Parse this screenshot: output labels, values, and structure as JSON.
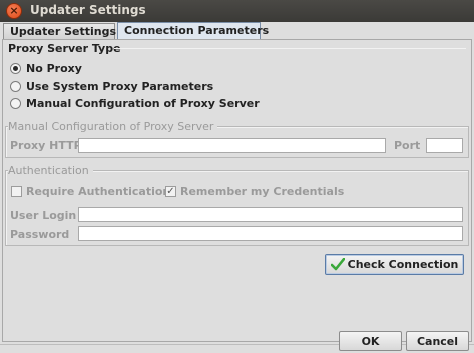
{
  "window": {
    "title": "Updater Settings",
    "close_glyph": "×"
  },
  "tabs": [
    {
      "label": "Updater Settings",
      "active": false
    },
    {
      "label": "Connection Parameters",
      "active": true
    }
  ],
  "proxy_type": {
    "title": "Proxy Server Type",
    "options": [
      {
        "label": "No Proxy",
        "checked": true
      },
      {
        "label": "Use System Proxy Parameters",
        "checked": false
      },
      {
        "label": "Manual Configuration of Proxy Server",
        "checked": false
      }
    ]
  },
  "manual_config": {
    "title": "Manual Configuration of Proxy Server",
    "proxy_http_label": "Proxy HTTP",
    "proxy_http_value": "",
    "port_label": "Port",
    "port_value": ""
  },
  "authentication": {
    "title": "Authentication",
    "require_auth_label": "Require Authentication",
    "require_auth_checked": false,
    "remember_label": "Remember my Credentials",
    "remember_checked": true,
    "user_login_label": "User Login",
    "user_login_value": "",
    "password_label": "Password",
    "password_value": ""
  },
  "buttons": {
    "check_connection": "Check Connection",
    "ok": "OK",
    "cancel": "Cancel"
  },
  "colors": {
    "check_icon": "#3aa83a",
    "titlebar": "#3c3b37",
    "active_tab": "#dfe6ef"
  }
}
